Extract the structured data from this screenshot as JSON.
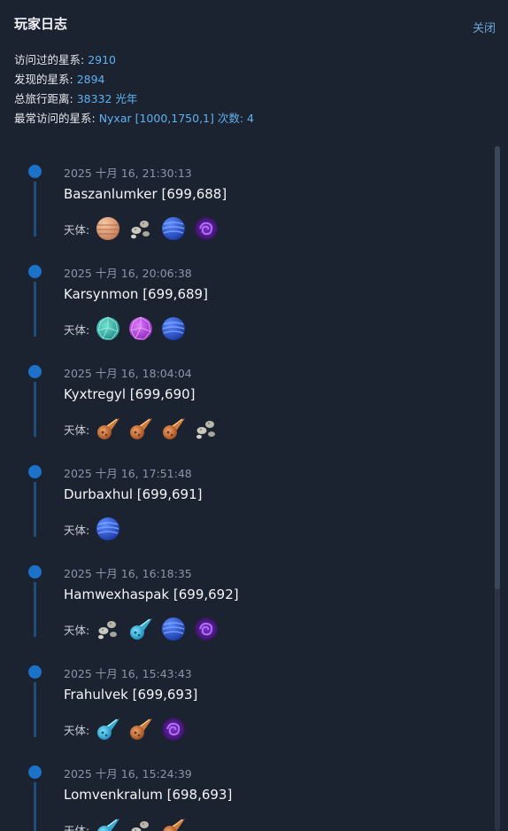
{
  "title": "玩家日志",
  "close_label": "关闭",
  "stats": {
    "visited": {
      "label": "访问过的星系: ",
      "value": "2910"
    },
    "discovered": {
      "label": "发现的星系: ",
      "value": "2894"
    },
    "distance": {
      "label": "总旅行距离: ",
      "value": "38332 光年"
    },
    "most_visited": {
      "label": "最常访问的星系: ",
      "value": "Nyxar [1000,1750,1] 次数: 4"
    }
  },
  "bodies_label": "天体:",
  "entries": [
    {
      "date": "2025 十月 16, 21:30:13",
      "name": "Baszanlumker [699,688]",
      "bodies": [
        "gas-giant",
        "asteroids",
        "ocean-planet",
        "nebula"
      ]
    },
    {
      "date": "2025 十月 16, 20:06:38",
      "name": "Karsynmon [699,689]",
      "bodies": [
        "crystal-teal",
        "crystal-purple",
        "ocean-planet"
      ]
    },
    {
      "date": "2025 十月 16, 18:04:04",
      "name": "Kyxtregyl [699,690]",
      "bodies": [
        "comet-orange",
        "comet-orange",
        "comet-orange",
        "asteroids"
      ]
    },
    {
      "date": "2025 十月 16, 17:51:48",
      "name": "Durbaxhul [699,691]",
      "bodies": [
        "ocean-planet"
      ]
    },
    {
      "date": "2025 十月 16, 16:18:35",
      "name": "Hamwexhaspak [699,692]",
      "bodies": [
        "asteroids",
        "comet-cyan",
        "ocean-planet",
        "nebula"
      ]
    },
    {
      "date": "2025 十月 16, 15:43:43",
      "name": "Frahulvek [699,693]",
      "bodies": [
        "comet-cyan",
        "comet-orange",
        "nebula"
      ]
    },
    {
      "date": "2025 十月 16, 15:24:39",
      "name": "Lomvenkralum [698,693]",
      "bodies": [
        "comet-cyan",
        "asteroids",
        "comet-orange"
      ]
    }
  ]
}
